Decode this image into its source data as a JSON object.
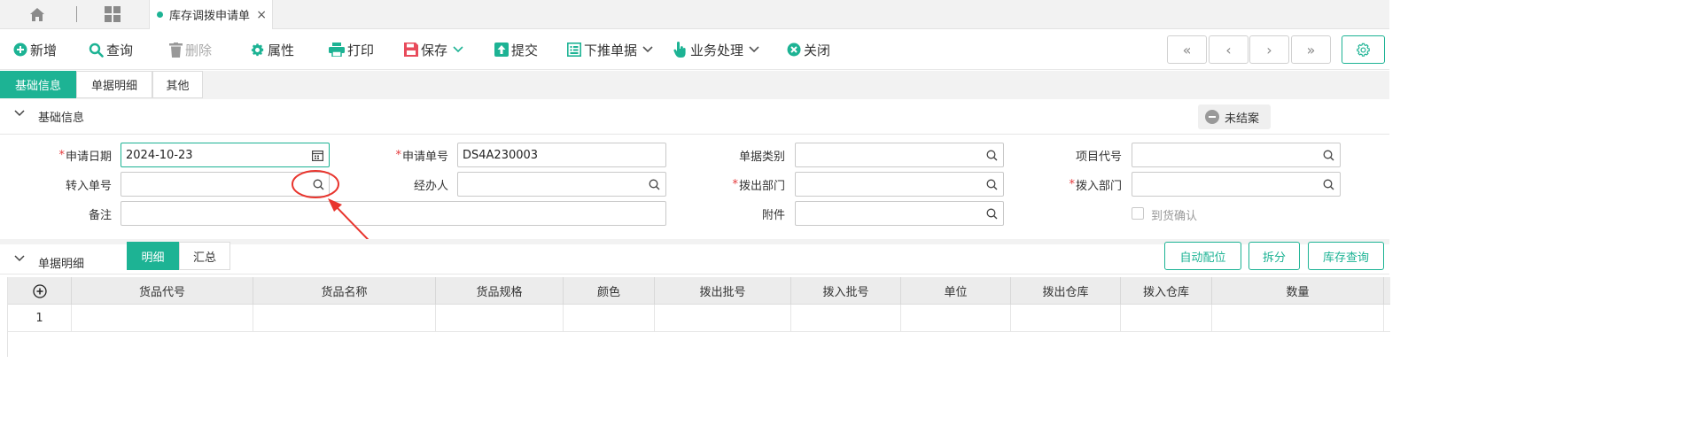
{
  "tabstrip": {
    "doc_tab_title": "库存调拨申请单",
    "close_glyph": "×"
  },
  "toolbar": {
    "add": "新增",
    "query": "查询",
    "delete": "删除",
    "properties": "属性",
    "print": "打印",
    "save": "保存",
    "submit": "提交",
    "push_down": "下推单据",
    "business": "业务处理",
    "close": "关闭"
  },
  "pager": {
    "first": "«",
    "prev": "‹",
    "next": "›",
    "last": "»"
  },
  "page_tabs": [
    "基础信息",
    "单据明细",
    "其他"
  ],
  "basic_section": {
    "title": "基础信息",
    "status": "未结案"
  },
  "form": {
    "apply_date": {
      "label": "申请日期",
      "value": "2024-10-23"
    },
    "apply_no": {
      "label": "申请单号",
      "value": "DS4A230003"
    },
    "doc_type": {
      "label": "单据类别",
      "value": ""
    },
    "project_code": {
      "label": "项目代号",
      "value": ""
    },
    "transfer_in_no": {
      "label": "转入单号",
      "value": ""
    },
    "handler": {
      "label": "经办人",
      "value": ""
    },
    "out_dept": {
      "label": "拨出部门",
      "value": ""
    },
    "in_dept": {
      "label": "拨入部门",
      "value": ""
    },
    "remark": {
      "label": "备注",
      "value": ""
    },
    "attachment": {
      "label": "附件",
      "value": ""
    },
    "arrival_confirm": {
      "label": "到货确认",
      "checked": false
    },
    "required_mark": "*"
  },
  "detail_section": {
    "title": "单据明细",
    "tabs": [
      "明细",
      "汇总"
    ],
    "buttons": [
      "自动配位",
      "拆分",
      "库存查询"
    ]
  },
  "grid": {
    "columns": [
      "货品代号",
      "货品名称",
      "货品规格",
      "颜色",
      "拨出批号",
      "拨入批号",
      "单位",
      "拨出仓库",
      "拨入仓库",
      "数量"
    ],
    "rows": [
      {
        "index": "1"
      }
    ]
  },
  "colors": {
    "accent": "#1db394",
    "required": "#e4393c",
    "annotation": "#e8352e",
    "delete_icon": "#999999",
    "save_icon": "#e84b5b"
  },
  "icons": [
    "home-icon",
    "grid-apps-icon",
    "plus-circle-icon",
    "search-icon",
    "trash-icon",
    "gear-icon",
    "printer-icon",
    "save-icon",
    "upload-icon",
    "list-icon",
    "hand-pointer-icon",
    "close-circle-icon",
    "calendar-icon",
    "chevron-down-icon",
    "minus-circle-icon",
    "add-row-icon"
  ]
}
